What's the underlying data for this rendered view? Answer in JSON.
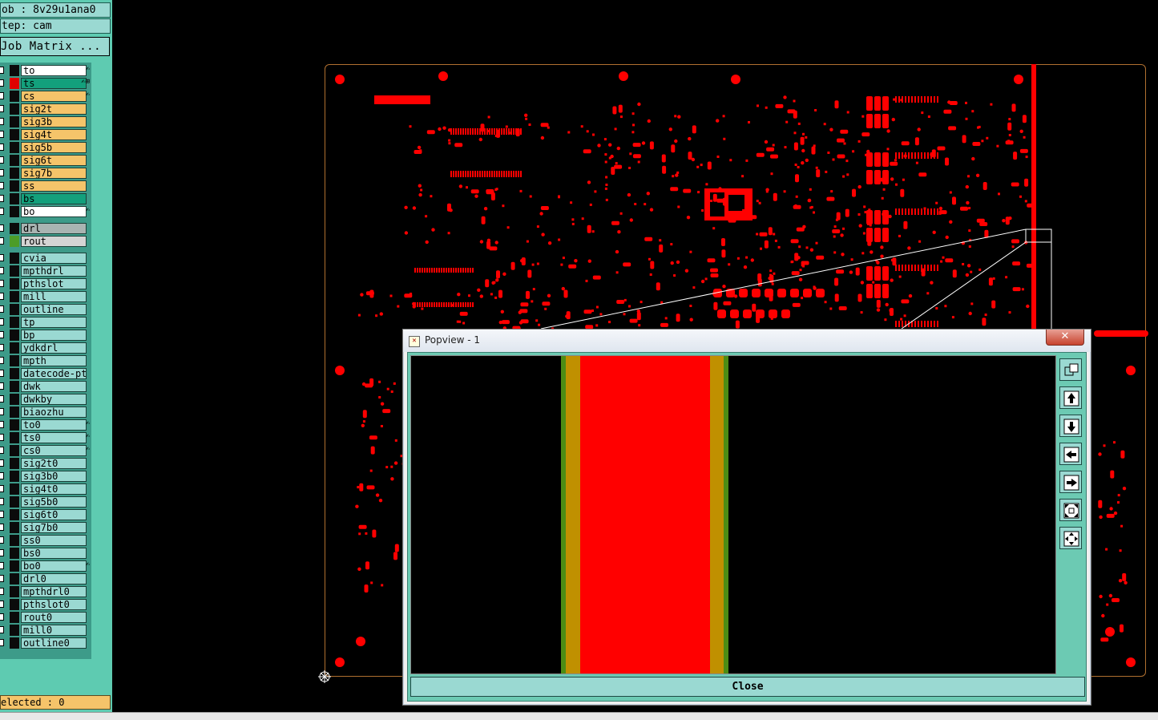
{
  "job_label": "ob : 8v29u1ana0",
  "step_label": "tep: cam",
  "job_matrix_button": "Job Matrix ...",
  "layers": [
    {
      "name": "to",
      "color": "#ffffff",
      "swatch": "#0b0b0b",
      "mark": "✍"
    },
    {
      "name": "ts",
      "color": "#13a07c",
      "swatch": "#e00000",
      "mark": "✍⊞"
    },
    {
      "name": "cs",
      "color": "#f5c46a",
      "swatch": "#0b0b0b",
      "mark": "✍"
    },
    {
      "name": "sig2t",
      "color": "#f5c46a",
      "swatch": "#0b0b0b",
      "mark": ""
    },
    {
      "name": "sig3b",
      "color": "#f5c46a",
      "swatch": "#0b0b0b",
      "mark": ""
    },
    {
      "name": "sig4t",
      "color": "#f5c46a",
      "swatch": "#0b0b0b",
      "mark": ""
    },
    {
      "name": "sig5b",
      "color": "#f5c46a",
      "swatch": "#0b0b0b",
      "mark": ""
    },
    {
      "name": "sig6t",
      "color": "#f5c46a",
      "swatch": "#0b0b0b",
      "mark": ""
    },
    {
      "name": "sig7b",
      "color": "#f5c46a",
      "swatch": "#0b0b0b",
      "mark": ""
    },
    {
      "name": "ss",
      "color": "#f5c46a",
      "swatch": "#0b0b0b",
      "mark": ""
    },
    {
      "name": "bs",
      "color": "#13a07c",
      "swatch": "#0b0b0b",
      "mark": ""
    },
    {
      "name": "bo",
      "color": "#ffffff",
      "swatch": "#0b0b0b",
      "mark": "✍"
    },
    {
      "name": "drl",
      "color": "#a9b4b2",
      "swatch": "#0b0b0b",
      "mark": ""
    },
    {
      "name": "rout",
      "color": "#d4d4d4",
      "swatch": "#4c9c28",
      "mark": ""
    },
    {
      "name": "cvia",
      "color": "#9ad9d2",
      "swatch": "#0b0b0b",
      "mark": ""
    },
    {
      "name": "mpthdrl",
      "color": "#9ad9d2",
      "swatch": "#0b0b0b",
      "mark": ""
    },
    {
      "name": "pthslot",
      "color": "#9ad9d2",
      "swatch": "#0b0b0b",
      "mark": ""
    },
    {
      "name": "mill",
      "color": "#9ad9d2",
      "swatch": "#0b0b0b",
      "mark": ""
    },
    {
      "name": "outline",
      "color": "#9ad9d2",
      "swatch": "#0b0b0b",
      "mark": ""
    },
    {
      "name": "tp",
      "color": "#9ad9d2",
      "swatch": "#0b0b0b",
      "mark": ""
    },
    {
      "name": "bp",
      "color": "#9ad9d2",
      "swatch": "#0b0b0b",
      "mark": ""
    },
    {
      "name": "ydkdrl",
      "color": "#9ad9d2",
      "swatch": "#0b0b0b",
      "mark": ""
    },
    {
      "name": "mpth",
      "color": "#9ad9d2",
      "swatch": "#0b0b0b",
      "mark": ""
    },
    {
      "name": "datecode-pt",
      "color": "#9ad9d2",
      "swatch": "#0b0b0b",
      "mark": ""
    },
    {
      "name": "dwk",
      "color": "#9ad9d2",
      "swatch": "#0b0b0b",
      "mark": ""
    },
    {
      "name": "dwkby",
      "color": "#9ad9d2",
      "swatch": "#0b0b0b",
      "mark": ""
    },
    {
      "name": "biaozhu",
      "color": "#9ad9d2",
      "swatch": "#0b0b0b",
      "mark": ""
    },
    {
      "name": "to0",
      "color": "#9ad9d2",
      "swatch": "#0b0b0b",
      "mark": "✍"
    },
    {
      "name": "ts0",
      "color": "#9ad9d2",
      "swatch": "#0b0b0b",
      "mark": "✍"
    },
    {
      "name": "cs0",
      "color": "#9ad9d2",
      "swatch": "#0b0b0b",
      "mark": "✍"
    },
    {
      "name": "sig2t0",
      "color": "#9ad9d2",
      "swatch": "#0b0b0b",
      "mark": ""
    },
    {
      "name": "sig3b0",
      "color": "#9ad9d2",
      "swatch": "#0b0b0b",
      "mark": ""
    },
    {
      "name": "sig4t0",
      "color": "#9ad9d2",
      "swatch": "#0b0b0b",
      "mark": ""
    },
    {
      "name": "sig5b0",
      "color": "#9ad9d2",
      "swatch": "#0b0b0b",
      "mark": ""
    },
    {
      "name": "sig6t0",
      "color": "#9ad9d2",
      "swatch": "#0b0b0b",
      "mark": ""
    },
    {
      "name": "sig7b0",
      "color": "#9ad9d2",
      "swatch": "#0b0b0b",
      "mark": ""
    },
    {
      "name": "ss0",
      "color": "#9ad9d2",
      "swatch": "#0b0b0b",
      "mark": ""
    },
    {
      "name": "bs0",
      "color": "#9ad9d2",
      "swatch": "#0b0b0b",
      "mark": ""
    },
    {
      "name": "bo0",
      "color": "#9ad9d2",
      "swatch": "#0b0b0b",
      "mark": "✍"
    },
    {
      "name": "drl0",
      "color": "#9ad9d2",
      "swatch": "#0b0b0b",
      "mark": ""
    },
    {
      "name": "mpthdrl0",
      "color": "#9ad9d2",
      "swatch": "#0b0b0b",
      "mark": ""
    },
    {
      "name": "pthslot0",
      "color": "#9ad9d2",
      "swatch": "#0b0b0b",
      "mark": ""
    },
    {
      "name": "rout0",
      "color": "#9ad9d2",
      "swatch": "#0b0b0b",
      "mark": ""
    },
    {
      "name": "mill0",
      "color": "#9ad9d2",
      "swatch": "#0b0b0b",
      "mark": ""
    },
    {
      "name": "outline0",
      "color": "#9ad9d2",
      "swatch": "#0b0b0b",
      "mark": ""
    }
  ],
  "selected_label": "elected : 0",
  "popview": {
    "title": "Popview - 1",
    "close_x": "✕",
    "close_button": "Close",
    "toolbar": [
      "zoom-window-icon",
      "pan-up-icon",
      "pan-down-icon",
      "pan-left-icon",
      "pan-right-icon",
      "zoom-home-icon",
      "zoom-fit-icon"
    ]
  },
  "colors": {
    "accent": "#5ecbb1",
    "copper": "#ff0000",
    "board_outline": "#b07030"
  }
}
